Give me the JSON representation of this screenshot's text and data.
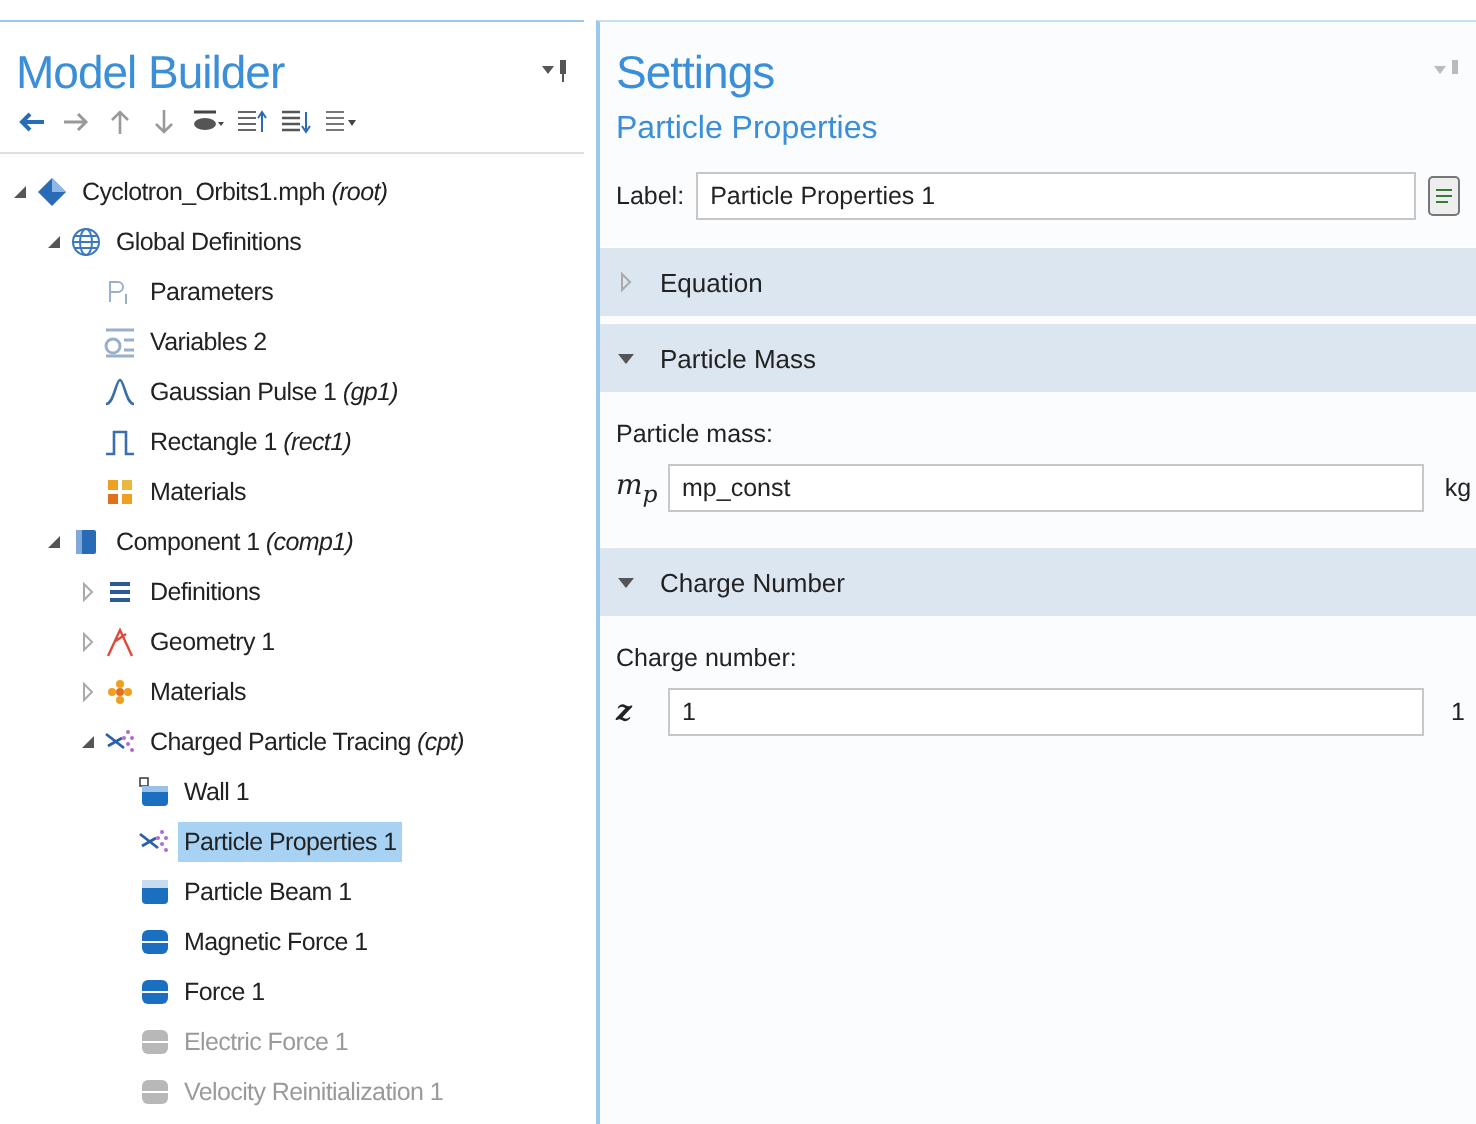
{
  "model_builder": {
    "title": "Model Builder",
    "tree": [
      {
        "label": "Cyclotron_Orbits1.mph *(root)*",
        "kind": "root",
        "expanded": true,
        "selected": false,
        "disabled": false,
        "children": [
          {
            "label": "Global Definitions",
            "kind": "globe",
            "expanded": true,
            "selected": false,
            "disabled": false,
            "children": [
              {
                "label": "Parameters",
                "kind": "parameters",
                "selected": false,
                "disabled": false
              },
              {
                "label": "Variables 2",
                "kind": "variables",
                "selected": false,
                "disabled": false
              },
              {
                "label": "Gaussian Pulse 1 *(gp1)*",
                "kind": "pulse",
                "selected": false,
                "disabled": false
              },
              {
                "label": "Rectangle 1 *(rect1)*",
                "kind": "rectangle",
                "selected": false,
                "disabled": false
              },
              {
                "label": "Materials",
                "kind": "materials",
                "selected": false,
                "disabled": false
              }
            ]
          },
          {
            "label": "Component 1 *(comp1)*",
            "kind": "component",
            "expanded": true,
            "selected": false,
            "disabled": false,
            "children": [
              {
                "label": "Definitions",
                "kind": "definitions",
                "expanded": false,
                "selected": false,
                "disabled": false
              },
              {
                "label": "Geometry 1",
                "kind": "geometry",
                "expanded": false,
                "selected": false,
                "disabled": false
              },
              {
                "label": "Materials",
                "kind": "materials-small",
                "expanded": false,
                "selected": false,
                "disabled": false
              },
              {
                "label": "Charged Particle Tracing *(cpt)*",
                "kind": "particles",
                "expanded": true,
                "selected": false,
                "disabled": false,
                "children": [
                  {
                    "label": "Wall 1",
                    "kind": "wall",
                    "selected": false,
                    "disabled": false
                  },
                  {
                    "label": "Particle Properties 1",
                    "kind": "particles",
                    "selected": true,
                    "disabled": false
                  },
                  {
                    "label": "Particle Beam 1",
                    "kind": "beam",
                    "selected": false,
                    "disabled": false
                  },
                  {
                    "label": "Magnetic Force 1",
                    "kind": "force",
                    "selected": false,
                    "disabled": false
                  },
                  {
                    "label": "Force 1",
                    "kind": "force",
                    "selected": false,
                    "disabled": false
                  },
                  {
                    "label": "Electric Force 1",
                    "kind": "force",
                    "selected": false,
                    "disabled": true
                  },
                  {
                    "label": "Velocity Reinitialization 1",
                    "kind": "force",
                    "selected": false,
                    "disabled": true
                  }
                ]
              }
            ]
          }
        ]
      }
    ]
  },
  "settings": {
    "title": "Settings",
    "subtitle": "Particle Properties",
    "label_field": {
      "label": "Label:",
      "value": "Particle Properties 1"
    },
    "sections": [
      {
        "title": "Equation",
        "expanded": false
      },
      {
        "title": "Particle Mass",
        "expanded": true,
        "field_label": "Particle mass:",
        "symbol": "m$_{p}$",
        "value": "mp_const",
        "unit": "kg"
      },
      {
        "title": "Charge Number",
        "expanded": true,
        "field_label": "Charge number:",
        "symbol": "**z**",
        "value": "1",
        "unit": "1"
      }
    ]
  }
}
